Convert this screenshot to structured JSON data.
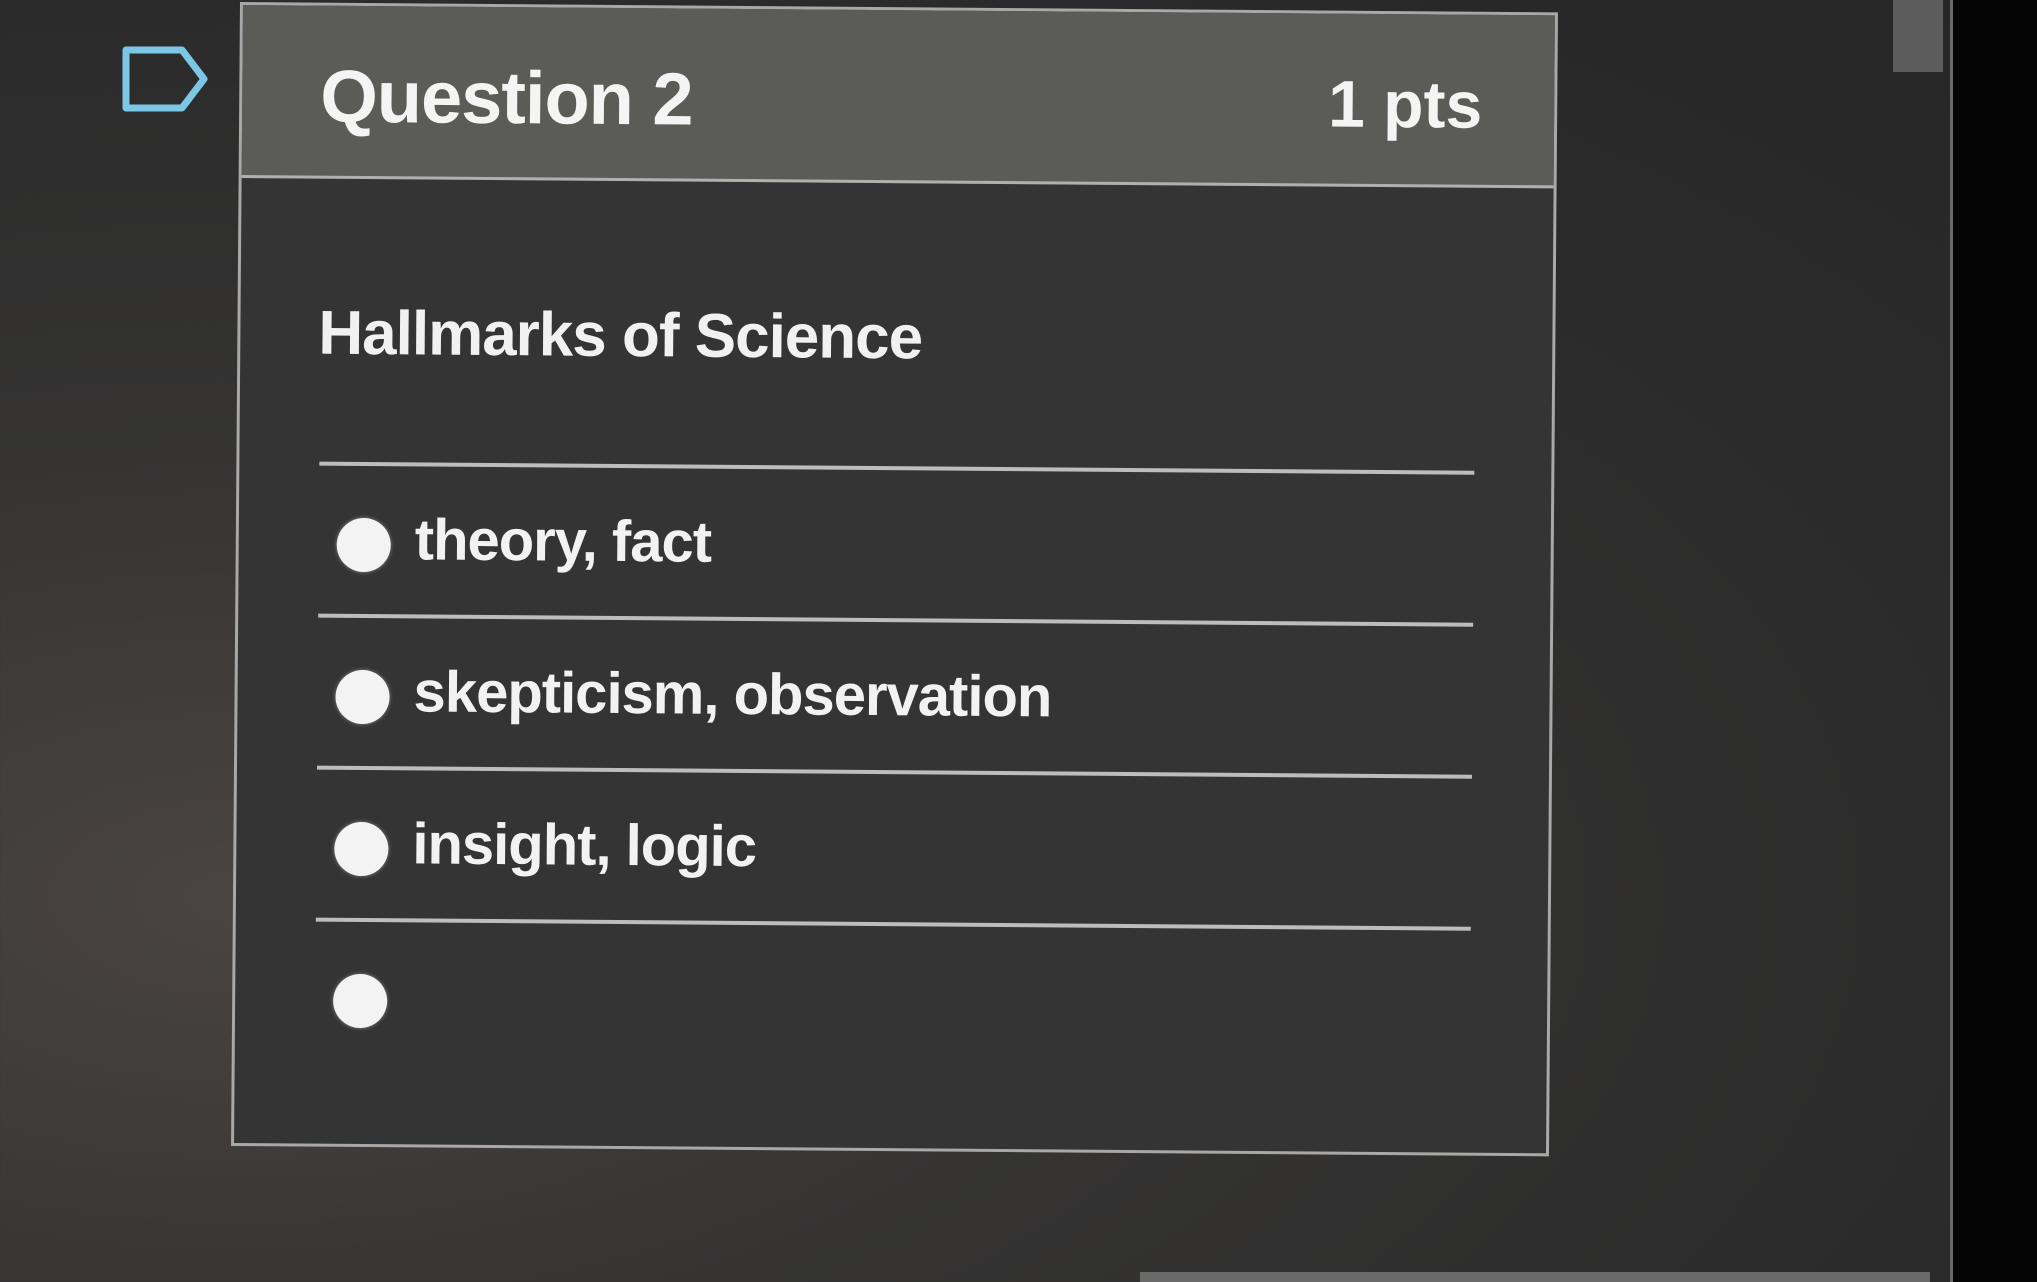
{
  "question": {
    "title": "Question 2",
    "points": "1 pts",
    "prompt": "Hallmarks of Science",
    "flag_icon": "flag-outline-icon",
    "accent_color": "#7cc6e6"
  },
  "answers": [
    {
      "label": "theory, fact"
    },
    {
      "label": "skepticism, observation"
    },
    {
      "label": "insight, logic"
    },
    {
      "label": ""
    }
  ]
}
